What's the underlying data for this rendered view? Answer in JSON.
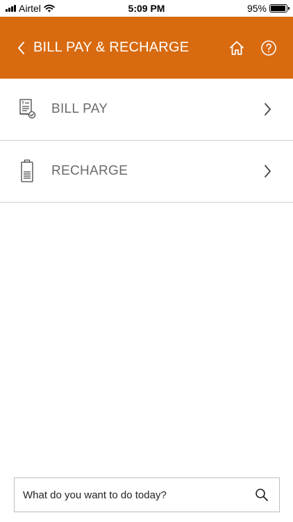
{
  "status_bar": {
    "carrier": "Airtel",
    "time": "5:09 PM",
    "battery_percent_label": "95%",
    "battery_level": 0.95
  },
  "header": {
    "title": "BILL PAY & RECHARGE",
    "background_color": "#d86a10",
    "icons": {
      "back": "chevron-left-icon",
      "home": "home-icon",
      "help": "help-circle-icon"
    }
  },
  "menu": {
    "items": [
      {
        "label": "BILL PAY",
        "icon": "bill-receipt-icon"
      },
      {
        "label": "RECHARGE",
        "icon": "battery-recharge-icon"
      }
    ]
  },
  "search": {
    "placeholder": "What do you want to do today?",
    "value": "",
    "icon": "search-icon"
  }
}
